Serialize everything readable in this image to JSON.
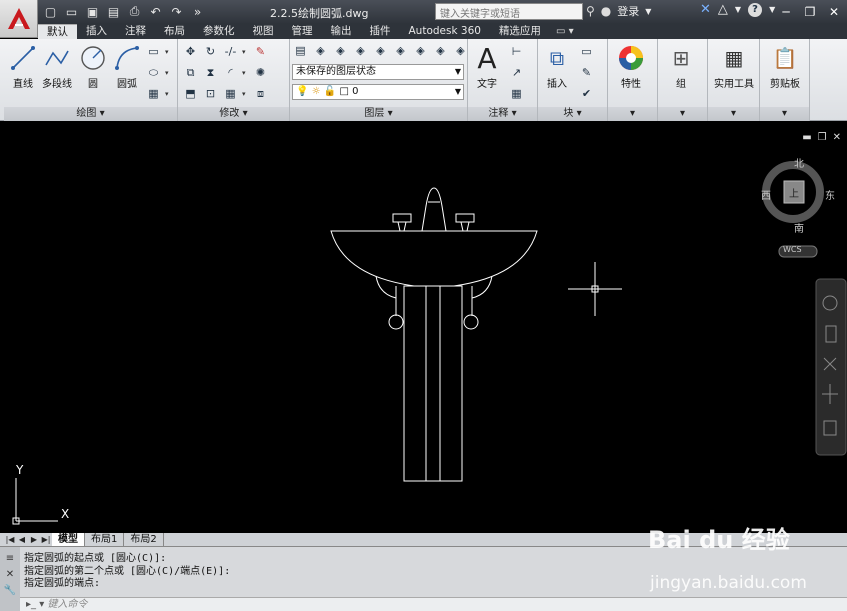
{
  "title_bar": {
    "document_title": "2.2.5绘制圆弧.dwg",
    "search_placeholder": "键入关键字或短语",
    "signin_label": "登录",
    "help_label": "?"
  },
  "tabs": [
    {
      "label": "默认",
      "active": true
    },
    {
      "label": "插入"
    },
    {
      "label": "注释"
    },
    {
      "label": "布局"
    },
    {
      "label": "参数化"
    },
    {
      "label": "视图"
    },
    {
      "label": "管理"
    },
    {
      "label": "输出"
    },
    {
      "label": "插件"
    },
    {
      "label": "Autodesk 360"
    },
    {
      "label": "精选应用"
    }
  ],
  "ribbon": {
    "draw": {
      "title": "绘图",
      "line": "直线",
      "polyline": "多段线",
      "circle": "圆",
      "arc": "圆弧"
    },
    "modify": {
      "title": "修改"
    },
    "layers": {
      "title": "图层",
      "layer_state": "未保存的图层状态",
      "current_layer": "0"
    },
    "annotation": {
      "title": "注释",
      "text": "文字"
    },
    "block": {
      "title": "块",
      "insert": "插入"
    },
    "properties": {
      "label": "特性"
    },
    "groups": {
      "label": "组"
    },
    "utilities": {
      "label": "实用工具"
    },
    "clipboard": {
      "label": "剪贴板"
    }
  },
  "viewcube": {
    "north": "北",
    "south": "南",
    "east": "东",
    "west": "西",
    "top": "上",
    "wcs": "WCS"
  },
  "ucs": {
    "x": "X",
    "y": "Y"
  },
  "layout_tabs": [
    {
      "label": "模型",
      "active": true
    },
    {
      "label": "布局1"
    },
    {
      "label": "布局2"
    }
  ],
  "command": {
    "lines": [
      "指定圆弧的起点或 [圆心(C)]:",
      "指定圆弧的第二个点或 [圆心(C)/端点(E)]:",
      "指定圆弧的端点:"
    ],
    "input_placeholder": "键入命令"
  },
  "watermark": {
    "brand": "Bai du 经验",
    "url": "jingyan.baidu.com"
  }
}
